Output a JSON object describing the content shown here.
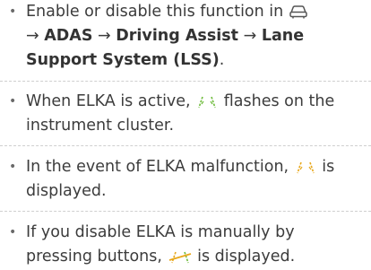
{
  "items": [
    {
      "pre": "Enable or disable this function in ",
      "icon": "car-settings-icon",
      "arrow1": " → ",
      "path1": "ADAS",
      "arrow2": " → ",
      "path2": "Driving Assist",
      "arrow3": " → ",
      "path3": "Lane Support System (LSS)",
      "post": "."
    },
    {
      "pre": "When ELKA is active, ",
      "icon": "lane-lines-green-icon",
      "post": " flashes on the instrument cluster."
    },
    {
      "pre": "In the event of ELKA malfunction, ",
      "icon": "lane-lines-yellow-icon",
      "post": " is displayed."
    },
    {
      "pre": "If you disable ELKA is manually by pressing buttons, ",
      "icon": "lane-lines-crossed-icon",
      "post": " is displayed."
    }
  ],
  "colors": {
    "text": "#3c3c3c",
    "green": "#6dbb3a",
    "yellow": "#e8a81c",
    "divider": "#cfcfcf"
  }
}
